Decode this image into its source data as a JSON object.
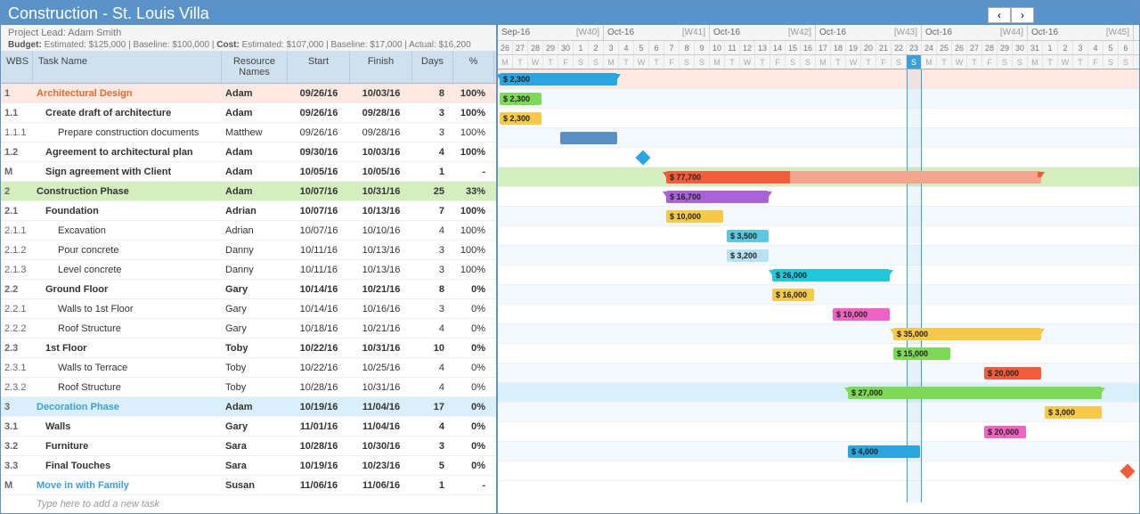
{
  "title": "Construction - St. Louis Villa",
  "project_lead_label": "Project Lead:",
  "project_lead": "Adam Smith",
  "budget_line": {
    "budget_label": "Budget:",
    "estimated": "Estimated: $125,000",
    "baseline": "Baseline: $100,000",
    "cost_label": "Cost:",
    "cost_estimated": "Estimated: $107,000",
    "cost_baseline": "Baseline: $17,000",
    "actual": "Actual: $16,200"
  },
  "columns": {
    "wbs": "WBS",
    "task": "Task Name",
    "resource": "Resource Names",
    "start": "Start",
    "finish": "Finish",
    "days": "Days",
    "pct": "%"
  },
  "new_task_placeholder": "Type here to add a new task",
  "timeline": {
    "start_day_index": 0,
    "day_width": 17,
    "weeks": [
      {
        "month": "Sep-16",
        "wk": "[W40]",
        "days": [
          "26",
          "27",
          "28",
          "29",
          "30",
          "1",
          "2"
        ],
        "dow": [
          "M",
          "T",
          "W",
          "T",
          "F",
          "S",
          "S"
        ]
      },
      {
        "month": "Oct-16",
        "wk": "[W41]",
        "days": [
          "3",
          "4",
          "5",
          "6",
          "7",
          "8",
          "9"
        ],
        "dow": [
          "M",
          "T",
          "W",
          "T",
          "F",
          "S",
          "S"
        ]
      },
      {
        "month": "Oct-16",
        "wk": "[W42]",
        "days": [
          "10",
          "11",
          "12",
          "13",
          "14",
          "15",
          "16"
        ],
        "dow": [
          "M",
          "T",
          "W",
          "T",
          "F",
          "S",
          "S"
        ]
      },
      {
        "month": "Oct-16",
        "wk": "[W43]",
        "days": [
          "17",
          "18",
          "19",
          "20",
          "21",
          "22",
          "23"
        ],
        "dow": [
          "M",
          "T",
          "W",
          "T",
          "F",
          "S",
          "S"
        ]
      },
      {
        "month": "Oct-16",
        "wk": "[W44]",
        "days": [
          "24",
          "25",
          "26",
          "27",
          "28",
          "29",
          "30"
        ],
        "dow": [
          "M",
          "T",
          "W",
          "T",
          "F",
          "S",
          "S"
        ]
      },
      {
        "month": "Oct-16",
        "wk": "[W45]",
        "days": [
          "31",
          "1",
          "2",
          "3",
          "4",
          "5",
          "6"
        ],
        "dow": [
          "M",
          "T",
          "W",
          "T",
          "F",
          "S",
          "S"
        ]
      }
    ],
    "today_index": 27
  },
  "tasks": [
    {
      "wbs": "1",
      "name": "Architectural Design",
      "res": "Adam",
      "start": "09/26/16",
      "finish": "10/03/16",
      "days": "8",
      "pct": "100%",
      "level": 0,
      "cls": "phase1",
      "bar": {
        "type": "summary",
        "from": 0,
        "to": 8,
        "color": "#2aa5e0",
        "label": "$ 2,300"
      }
    },
    {
      "wbs": "1.1",
      "name": "Create draft of architecture",
      "res": "Adam",
      "start": "09/26/16",
      "finish": "09/28/16",
      "days": "3",
      "pct": "100%",
      "level": 1,
      "bar": {
        "type": "task",
        "from": 0,
        "to": 3,
        "color": "#7ed957",
        "label": "$ 2,300"
      }
    },
    {
      "wbs": "1.1.1",
      "name": "Prepare construction documents",
      "res": "Matthew",
      "start": "09/26/16",
      "finish": "09/28/16",
      "days": "3",
      "pct": "100%",
      "level": 2,
      "bar": {
        "type": "task",
        "from": 0,
        "to": 3,
        "color": "#f7c948",
        "label": "$ 2,300"
      }
    },
    {
      "wbs": "1.2",
      "name": "Agreement to architectural plan",
      "res": "Adam",
      "start": "09/30/16",
      "finish": "10/03/16",
      "days": "4",
      "pct": "100%",
      "level": 1,
      "bar": {
        "type": "task",
        "from": 4,
        "to": 8,
        "color": "#5a8fc5",
        "label": ""
      }
    },
    {
      "wbs": "M",
      "name": "Sign agreement with Client",
      "res": "Adam",
      "start": "10/05/16",
      "finish": "10/05/16",
      "days": "1",
      "pct": "-",
      "level": 1,
      "bar": {
        "type": "milestone",
        "at": 9,
        "color": "#2aa5e0"
      }
    },
    {
      "wbs": "2",
      "name": "Construction Phase",
      "res": "Adam",
      "start": "10/07/16",
      "finish": "10/31/16",
      "days": "25",
      "pct": "33%",
      "level": 0,
      "cls": "phase2",
      "bar": {
        "type": "summary",
        "from": 11,
        "to": 36,
        "color": "#f25c3b",
        "label": "$ 77,700",
        "progress": 0.33,
        "fade": "#f4a58f"
      }
    },
    {
      "wbs": "2.1",
      "name": "Foundation",
      "res": "Adrian",
      "start": "10/07/16",
      "finish": "10/13/16",
      "days": "7",
      "pct": "100%",
      "level": 1,
      "bar": {
        "type": "summary",
        "from": 11,
        "to": 18,
        "color": "#a863d8",
        "label": "$ 16,700"
      }
    },
    {
      "wbs": "2.1.1",
      "name": "Excavation",
      "res": "Adrian",
      "start": "10/07/16",
      "finish": "10/10/16",
      "days": "4",
      "pct": "100%",
      "level": 2,
      "bar": {
        "type": "task",
        "from": 11,
        "to": 15,
        "color": "#f7c948",
        "label": "$ 10,000"
      }
    },
    {
      "wbs": "2.1.2",
      "name": "Pour concrete",
      "res": "Danny",
      "start": "10/11/16",
      "finish": "10/13/16",
      "days": "3",
      "pct": "100%",
      "level": 2,
      "bar": {
        "type": "task",
        "from": 15,
        "to": 18,
        "color": "#5bc8de",
        "label": "$ 3,500"
      }
    },
    {
      "wbs": "2.1.3",
      "name": "Level concrete",
      "res": "Danny",
      "start": "10/11/16",
      "finish": "10/13/16",
      "days": "3",
      "pct": "100%",
      "level": 2,
      "bar": {
        "type": "task",
        "from": 15,
        "to": 18,
        "color": "#b8e2f2",
        "label": "$ 3,200"
      }
    },
    {
      "wbs": "2.2",
      "name": "Ground Floor",
      "res": "Gary",
      "start": "10/14/16",
      "finish": "10/21/16",
      "days": "8",
      "pct": "0%",
      "level": 1,
      "bar": {
        "type": "summary",
        "from": 18,
        "to": 26,
        "color": "#1fc8db",
        "label": "$ 26,000"
      }
    },
    {
      "wbs": "2.2.1",
      "name": "Walls to 1st Floor",
      "res": "Gary",
      "start": "10/14/16",
      "finish": "10/16/16",
      "days": "3",
      "pct": "0%",
      "level": 2,
      "bar": {
        "type": "task",
        "from": 18,
        "to": 21,
        "color": "#f7c948",
        "label": "$ 16,000"
      }
    },
    {
      "wbs": "2.2.2",
      "name": "Roof Structure",
      "res": "Gary",
      "start": "10/18/16",
      "finish": "10/21/16",
      "days": "4",
      "pct": "0%",
      "level": 2,
      "bar": {
        "type": "task",
        "from": 22,
        "to": 26,
        "color": "#f262c4",
        "label": "$ 10,000"
      }
    },
    {
      "wbs": "2.3",
      "name": "1st Floor",
      "res": "Toby",
      "start": "10/22/16",
      "finish": "10/31/16",
      "days": "10",
      "pct": "0%",
      "level": 1,
      "bar": {
        "type": "summary",
        "from": 26,
        "to": 36,
        "color": "#f7c948",
        "label": "$ 35,000"
      }
    },
    {
      "wbs": "2.3.1",
      "name": "Walls to Terrace",
      "res": "Toby",
      "start": "10/22/16",
      "finish": "10/25/16",
      "days": "4",
      "pct": "0%",
      "level": 2,
      "bar": {
        "type": "task",
        "from": 26,
        "to": 30,
        "color": "#7ed957",
        "label": "$ 15,000"
      }
    },
    {
      "wbs": "2.3.2",
      "name": "Roof Structure",
      "res": "Toby",
      "start": "10/28/16",
      "finish": "10/31/16",
      "days": "4",
      "pct": "0%",
      "level": 2,
      "bar": {
        "type": "task",
        "from": 32,
        "to": 36,
        "color": "#f25c3b",
        "label": "$ 20,000"
      }
    },
    {
      "wbs": "3",
      "name": "Decoration Phase",
      "res": "Adam",
      "start": "10/19/16",
      "finish": "11/04/16",
      "days": "17",
      "pct": "0%",
      "level": 0,
      "cls": "phase3",
      "bar": {
        "type": "summary",
        "from": 23,
        "to": 40,
        "color": "#7ed957",
        "label": "$ 27,000"
      }
    },
    {
      "wbs": "3.1",
      "name": "Walls",
      "res": "Gary",
      "start": "11/01/16",
      "finish": "11/04/16",
      "days": "4",
      "pct": "0%",
      "level": 1,
      "bar": {
        "type": "task",
        "from": 36,
        "to": 40,
        "color": "#f7c948",
        "label": "$ 3,000"
      }
    },
    {
      "wbs": "3.2",
      "name": "Furniture",
      "res": "Sara",
      "start": "10/28/16",
      "finish": "10/30/16",
      "days": "3",
      "pct": "0%",
      "level": 1,
      "bar": {
        "type": "task",
        "from": 32,
        "to": 35,
        "color": "#f262c4",
        "label": "$ 20,000"
      }
    },
    {
      "wbs": "3.3",
      "name": "Final Touches",
      "res": "Sara",
      "start": "10/19/16",
      "finish": "10/23/16",
      "days": "5",
      "pct": "0%",
      "level": 1,
      "bar": {
        "type": "task",
        "from": 23,
        "to": 28,
        "color": "#2aa5e0",
        "label": "$ 4,000"
      }
    },
    {
      "wbs": "M",
      "name": "Move in with Family",
      "res": "Susan",
      "start": "11/06/16",
      "finish": "11/06/16",
      "days": "1",
      "pct": "-",
      "level": 0,
      "cls": "milestone",
      "bar": {
        "type": "milestone",
        "at": 41,
        "color": "#f25c3b"
      }
    }
  ]
}
